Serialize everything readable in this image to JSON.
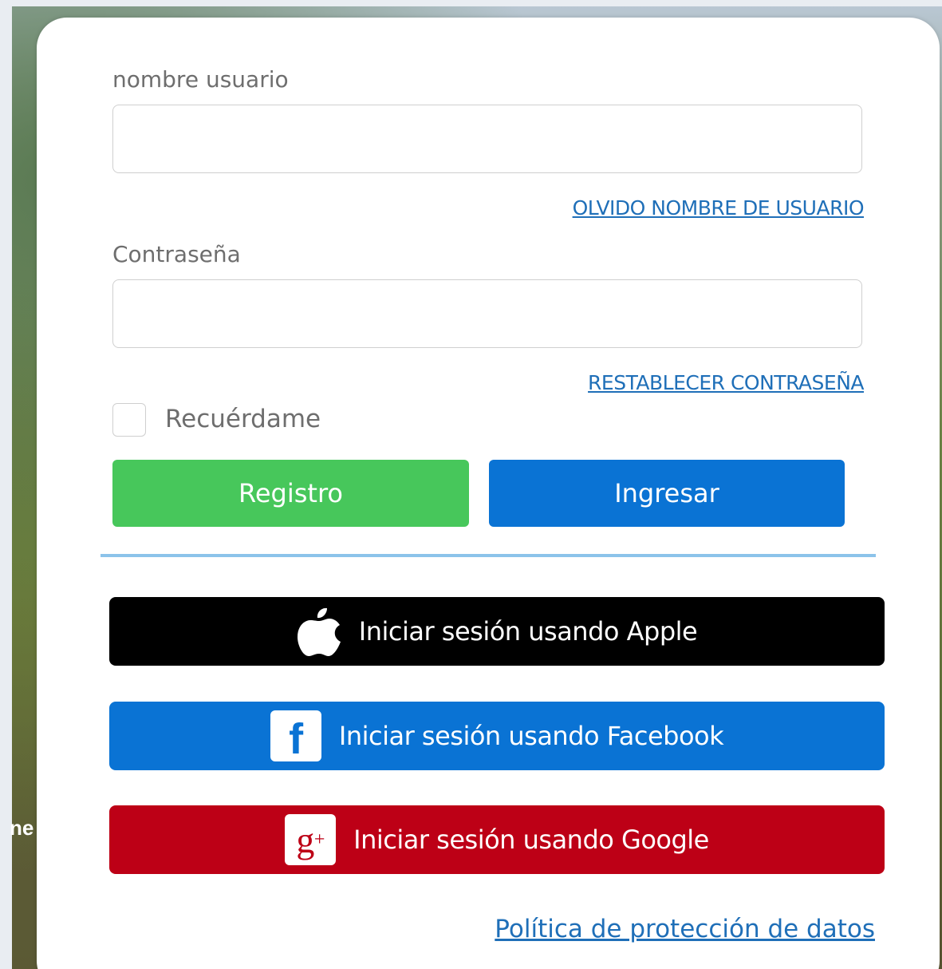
{
  "background": {
    "partial_text": "ne"
  },
  "form": {
    "username_label": "nombre usuario",
    "username_value": "",
    "forgot_username_link": "OLVIDO NOMBRE DE USUARIO",
    "password_label": "Contraseña",
    "password_value": "",
    "reset_password_link": "RESTABLECER CONTRASEÑA",
    "remember_label": "Recuérdame",
    "remember_checked": false,
    "register_button": "Registro",
    "login_button": "Ingresar"
  },
  "social": {
    "apple": {
      "label": "Iniciar sesión usando Apple",
      "icon": "apple-icon",
      "color": "#000000"
    },
    "facebook": {
      "label": "Iniciar sesión usando Facebook",
      "icon": "facebook-icon",
      "glyph": "f",
      "color": "#0a73d4"
    },
    "google": {
      "label": "Iniciar sesión usando Google",
      "icon": "google-plus-icon",
      "glyph": "g",
      "glyph_sup": "+",
      "color": "#bd0016"
    }
  },
  "footer": {
    "privacy_link": "Política de protección de datos"
  },
  "colors": {
    "register_green": "#47c75b",
    "primary_blue": "#0a73d4",
    "link_blue": "#1f6fb8",
    "divider": "#8cc3ea"
  }
}
